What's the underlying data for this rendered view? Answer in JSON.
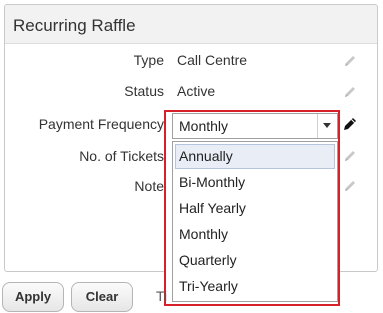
{
  "panel": {
    "title": "Recurring Raffle"
  },
  "fields": {
    "type": {
      "label": "Type",
      "value": "Call Centre"
    },
    "status": {
      "label": "Status",
      "value": "Active"
    },
    "payment_frequency": {
      "label": "Payment Frequency"
    },
    "tickets": {
      "label": "No. of Tickets"
    },
    "note": {
      "label": "Note"
    }
  },
  "payment_frequency_select": {
    "selected_value": "Monthly",
    "options": [
      "Annually",
      "Bi-Monthly",
      "Half Yearly",
      "Monthly",
      "Quarterly",
      "Tri-Yearly"
    ],
    "highlighted_option": "Annually"
  },
  "footer": {
    "apply_label": "Apply",
    "clear_label": "Clear",
    "partial_text": "Ti"
  },
  "colors": {
    "highlight_border": "#d6202a",
    "header_background": "#f2f2f2",
    "hovered_option_background": "#e8edf6"
  }
}
